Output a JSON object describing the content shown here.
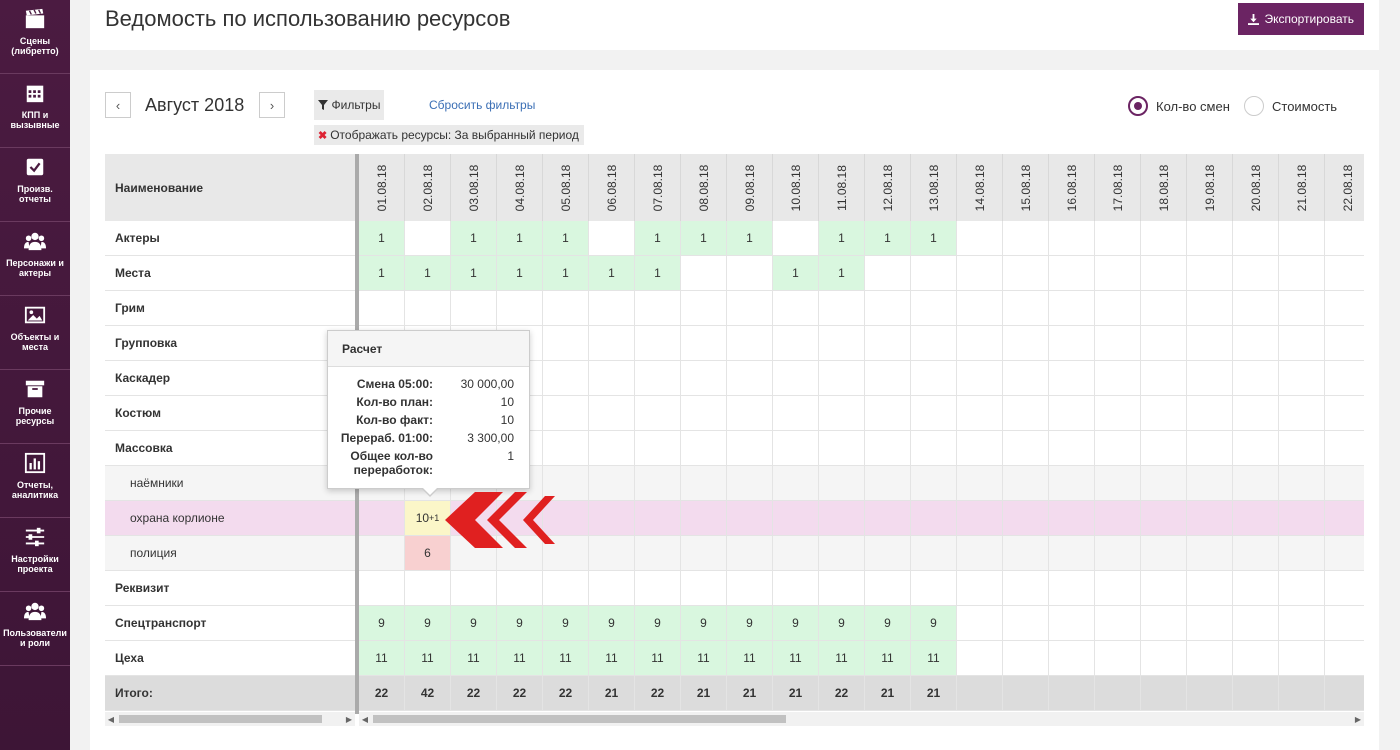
{
  "sidebar": {
    "items": [
      {
        "label": "Сцены (либретто)",
        "icon": "clapperboard-icon"
      },
      {
        "label": "КПП и вызывные",
        "icon": "calendar-icon"
      },
      {
        "label": "Произв. отчеты",
        "icon": "checkbox-icon"
      },
      {
        "label": "Персонажи и актеры",
        "icon": "users-icon"
      },
      {
        "label": "Объекты и места",
        "icon": "image-icon"
      },
      {
        "label": "Прочие ресурсы",
        "icon": "archive-icon"
      },
      {
        "label": "Отчеты, аналитика",
        "icon": "bar-chart-icon"
      },
      {
        "label": "Настройки проекта",
        "icon": "sliders-icon"
      },
      {
        "label": "Пользователи и роли",
        "icon": "user-group-icon"
      }
    ]
  },
  "header": {
    "title": "Ведомость по использованию ресурсов",
    "export_label": "Экспортировать"
  },
  "toolbar": {
    "prev": "‹",
    "next": "›",
    "month": "Август 2018",
    "filters_label": "Фильтры",
    "reset_filters": "Сбросить фильтры",
    "filter_chip": "Отображать ресурсы: За выбранный период",
    "radio_shifts": "Кол-во смен",
    "radio_cost": "Стоимость",
    "selected_mode": "shifts"
  },
  "table": {
    "name_header": "Наименование",
    "days": [
      "01.08.18",
      "02.08.18",
      "03.08.18",
      "04.08.18",
      "05.08.18",
      "06.08.18",
      "07.08.18",
      "08.08.18",
      "09.08.18",
      "10.08.18",
      "11.08.18",
      "12.08.18",
      "13.08.18",
      "14.08.18",
      "15.08.18",
      "16.08.18",
      "17.08.18",
      "18.08.18",
      "19.08.18",
      "20.08.18",
      "21.08.18",
      "22.08.18"
    ],
    "rows": [
      {
        "name": "Актеры",
        "type": "main",
        "cells": [
          "1",
          "",
          "1",
          "1",
          "1",
          "",
          "1",
          "1",
          "1",
          "",
          "1",
          "1",
          "1",
          "",
          "",
          "",
          "",
          "",
          "",
          "",
          "",
          ""
        ],
        "colors": [
          "green",
          "",
          "green",
          "green",
          "green",
          "",
          "green",
          "green",
          "green",
          "",
          "green",
          "green",
          "green",
          "",
          "",
          "",
          "",
          "",
          "",
          "",
          "",
          ""
        ]
      },
      {
        "name": "Места",
        "type": "main",
        "cells": [
          "1",
          "1",
          "1",
          "1",
          "1",
          "1",
          "1",
          "",
          "",
          "1",
          "1",
          "",
          "",
          "",
          "",
          "",
          "",
          "",
          "",
          "",
          "",
          ""
        ],
        "colors": [
          "green",
          "green",
          "green",
          "green",
          "green",
          "green",
          "green",
          "",
          "",
          "green",
          "green",
          "",
          "",
          "",
          "",
          "",
          "",
          "",
          "",
          "",
          "",
          ""
        ]
      },
      {
        "name": "Грим",
        "type": "main",
        "cells": [],
        "colors": []
      },
      {
        "name": "Групповка",
        "type": "main",
        "cells": [],
        "colors": []
      },
      {
        "name": "Каскадер",
        "type": "main",
        "cells": [],
        "colors": []
      },
      {
        "name": "Костюм",
        "type": "main",
        "cells": [],
        "colors": []
      },
      {
        "name": "Массовка",
        "type": "main",
        "cells": [],
        "colors": []
      },
      {
        "name": "наёмники",
        "type": "sub",
        "cells": [],
        "colors": []
      },
      {
        "name": "охрана корлионе",
        "type": "pink",
        "cells": [
          "",
          "10"
        ],
        "sup": [
          "",
          "+1"
        ],
        "colors": [
          "",
          "yellow"
        ]
      },
      {
        "name": "полиция",
        "type": "sub",
        "cells": [
          "",
          "6"
        ],
        "colors": [
          "",
          "red"
        ]
      },
      {
        "name": "Реквизит",
        "type": "main",
        "cells": [],
        "colors": []
      },
      {
        "name": "Спецтранспорт",
        "type": "main",
        "cells": [
          "9",
          "9",
          "9",
          "9",
          "9",
          "9",
          "9",
          "9",
          "9",
          "9",
          "9",
          "9",
          "9"
        ],
        "colors": [
          "green",
          "green",
          "green",
          "green",
          "green",
          "green",
          "green",
          "green",
          "green",
          "green",
          "green",
          "green",
          "green"
        ]
      },
      {
        "name": "Цеха",
        "type": "main",
        "cells": [
          "11",
          "11",
          "11",
          "11",
          "11",
          "11",
          "11",
          "11",
          "11",
          "11",
          "11",
          "11",
          "11"
        ],
        "colors": [
          "green",
          "green",
          "green",
          "green",
          "green",
          "green",
          "green",
          "green",
          "green",
          "green",
          "green",
          "green",
          "green"
        ]
      },
      {
        "name": "Итого:",
        "type": "total",
        "cells": [
          "22",
          "42",
          "22",
          "22",
          "22",
          "21",
          "22",
          "21",
          "21",
          "21",
          "22",
          "21",
          "21"
        ],
        "colors": []
      }
    ]
  },
  "tooltip": {
    "title": "Расчет",
    "rows": [
      {
        "k": "Смена 05:00:",
        "v": "30 000,00"
      },
      {
        "k": "Кол-во план:",
        "v": "10"
      },
      {
        "k": "Кол-во факт:",
        "v": "10"
      },
      {
        "k": "Перераб. 01:00:",
        "v": "3 300,00"
      },
      {
        "k": "Общее кол-во переработок:",
        "v": "1"
      }
    ]
  },
  "colors": {
    "sidebar_bg": "#4b1b41",
    "accent": "#6b2463",
    "green_cell": "#d9f7df",
    "yellow_cell": "#fbf6c8",
    "red_cell": "#f8d0d0",
    "pink_row": "#f3dbee",
    "pointer_arrow": "#e02020"
  }
}
